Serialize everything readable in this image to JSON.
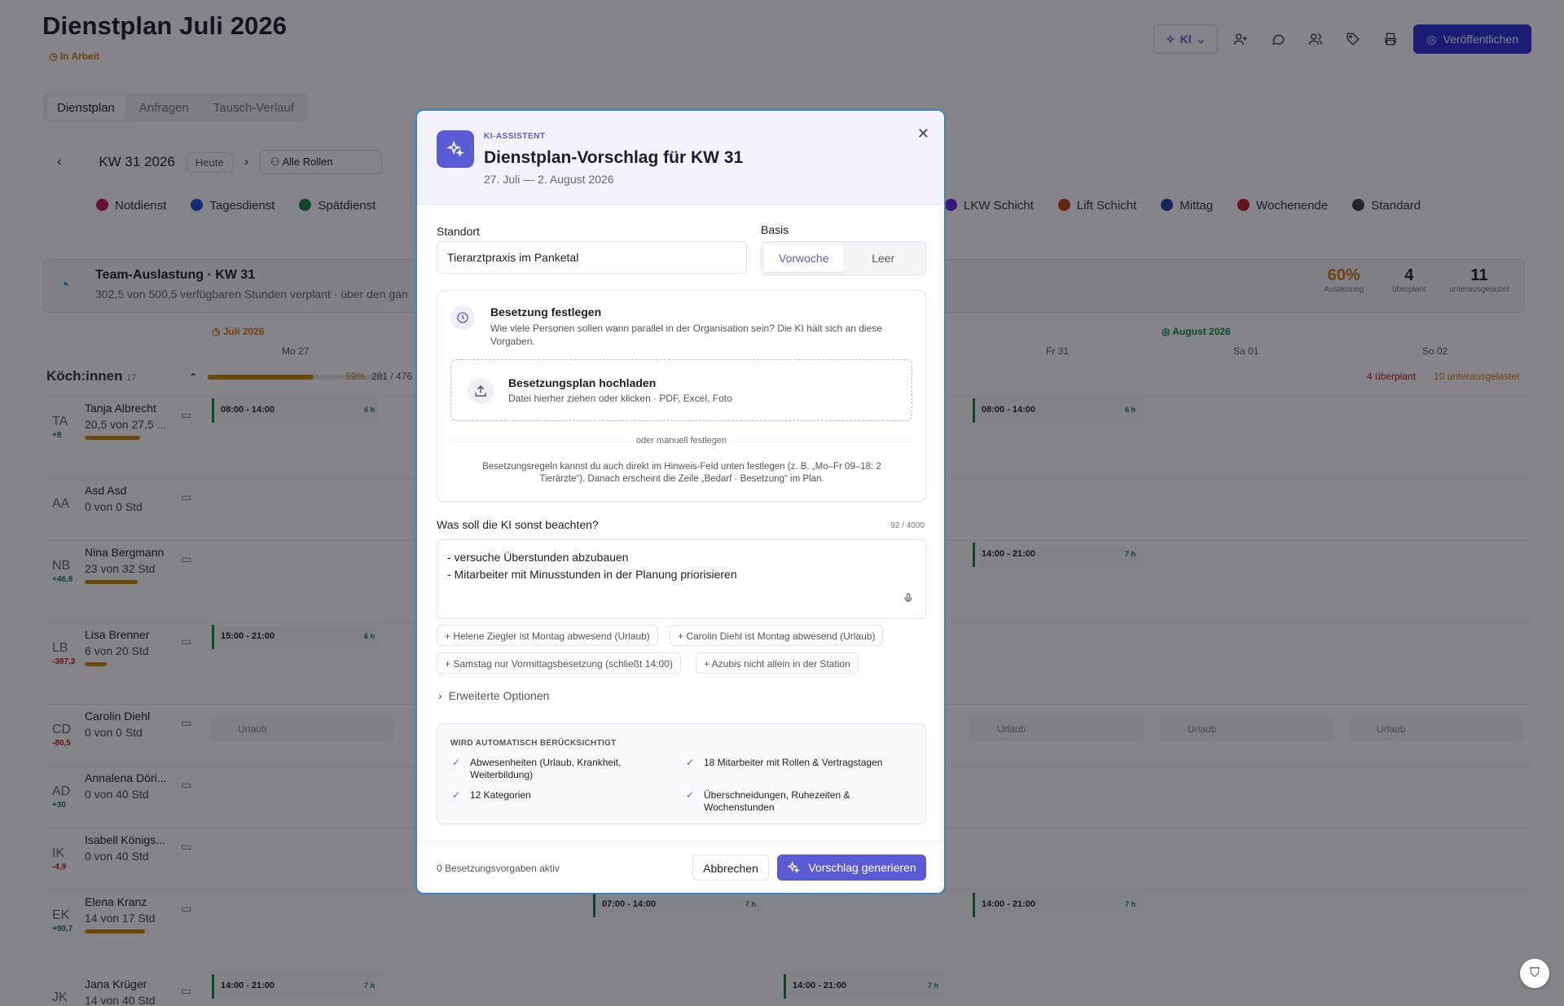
{
  "page": {
    "title": "Dienstplan Juli 2026",
    "status": "In Arbeit",
    "ki_label": "KI",
    "publish_label": "Veröffentlichen",
    "tabs": [
      "Dienstplan",
      "Anfragen",
      "Tausch-Verlauf"
    ],
    "week": "KW 31 2026",
    "today": "Heute",
    "roles": "Alle Rollen"
  },
  "legend_left": [
    {
      "label": "Notdienst",
      "color": "#be185d"
    },
    {
      "label": "Tagesdienst",
      "color": "#1d4ed8"
    },
    {
      "label": "Spätdienst",
      "color": "#15803d"
    }
  ],
  "legend_right": [
    {
      "label": "LKW Schicht",
      "color": "#6d28d9"
    },
    {
      "label": "Lift Schicht",
      "color": "#c2410c"
    },
    {
      "label": "Mittag",
      "color": "#1e40af"
    },
    {
      "label": "Wochenende",
      "color": "#b91c1c"
    },
    {
      "label": "Standard",
      "color": "#3f3f46"
    }
  ],
  "team": {
    "title": "Team-Auslastung · KW 31",
    "subtitle": "302,5 von 500,5 verfügbaren Stunden verplant · über den gan",
    "stats": [
      {
        "value": "60%",
        "label": "Auslastung",
        "color": "#d97706"
      },
      {
        "value": "4",
        "label": "überplant",
        "color": "#222"
      },
      {
        "value": "11",
        "label": "unterausgelastet",
        "color": "#222"
      }
    ]
  },
  "calendar": {
    "month_july": "Juli 2026",
    "month_aug": "August 2026",
    "days": [
      "Mo 27",
      "Fr 31",
      "Sa 01",
      "So 02"
    ],
    "group": "Köch:innen",
    "group_count": "17",
    "group_pct": "59%",
    "group_hours": "281 / 476",
    "group_progress": 0.59,
    "over": "4 überplant",
    "under": "10 unterausgelastet"
  },
  "employees": [
    {
      "ini": "TA",
      "name": "Tanja Albrecht",
      "hours": "20,5 von 27,5 ...",
      "bal": "+8",
      "balc": "#15803d",
      "bar": 0.75
    },
    {
      "ini": "AA",
      "name": "Asd Asd",
      "hours": "0 von 0 Std",
      "bal": "",
      "balc": "#15803d",
      "bar": 0
    },
    {
      "ini": "NB",
      "name": "Nina Bergmann",
      "hours": "23 von 32 Std",
      "bal": "+46,8",
      "balc": "#15803d",
      "bar": 0.72
    },
    {
      "ini": "LB",
      "name": "Lisa Brenner",
      "hours": "6 von 20 Std",
      "bal": "-387,3",
      "balc": "#b91c1c",
      "bar": 0.3
    },
    {
      "ini": "CD",
      "name": "Carolin Diehl",
      "hours": "0 von 0 Std",
      "bal": "-80,5",
      "balc": "#b91c1c",
      "bar": 0
    },
    {
      "ini": "AD",
      "name": "Annalena Döri...",
      "hours": "0 von 40 Std",
      "bal": "+30",
      "balc": "#15803d",
      "bar": 0
    },
    {
      "ini": "IK",
      "name": "Isabell Königs...",
      "hours": "0 von 40 Std",
      "bal": "-4,9",
      "balc": "#b91c1c",
      "bar": 0
    },
    {
      "ini": "EK",
      "name": "Elena Kranz",
      "hours": "14 von 17 Std",
      "bal": "+90,7",
      "balc": "#15803d",
      "bar": 0.82
    },
    {
      "ini": "JK",
      "name": "Jana Krüger",
      "hours": "14 von 40 Std",
      "bal": "",
      "balc": "#15803d",
      "bar": 0
    }
  ],
  "shifts": {
    "s1": "08:00 - 14:00",
    "s1h": "6 h",
    "s2": "08:00 - 14:00",
    "s2h": "6 h",
    "s3": "14:00 - 21:00",
    "s3h": "7 h",
    "s4": "15:00 - 21:00",
    "s4h": "6 h",
    "s5": "07:00 - 14:00",
    "s5h": "7 h",
    "s6": "14:00 - 21:00",
    "s6h": "7 h",
    "s7": "14:00 - 21:00",
    "s7h": "7 h",
    "s8": "14:00 - 21:00",
    "s8h": "7 h",
    "urlaub": "Urlaub"
  },
  "modal": {
    "eyebrow": "KI-ASSISTENT",
    "title": "Dienstplan-Vorschlag für KW 31",
    "date_range": "27. Juli — 2. August 2026",
    "standort_label": "Standort",
    "standort_value": "Tierarztpraxis im Panketal",
    "basis_label": "Basis",
    "basis_options": [
      "Vorwoche",
      "Leer"
    ],
    "besetzung_title": "Besetzung festlegen",
    "besetzung_desc": "Wie viele Personen sollen wann parallel in der Organisation sein? Die KI hält sich an diese Vorgaben.",
    "upload_title": "Besetzungsplan hochladen",
    "upload_sub": "Datei hierher ziehen oder klicken · PDF, Excel, Foto",
    "or_text": "oder manuell festlegen",
    "hint": "Besetzungsregeln kannst du auch direkt im Hinweis-Feld unten festlegen (z. B. „Mo–Fr 09–18: 2 Tierärzte“). Danach erscheint die Zeile „Bedarf · Besetzung“ im Plan.",
    "notes_label": "Was soll die KI sonst beachten?",
    "notes_counter": "92 / 4000",
    "notes_line1": "- versuche Überstunden abzubauen",
    "notes_line2": "- Mitarbeiter mit Minusstunden in der Planung priorisieren",
    "chips": [
      "+ Helene Ziegler ist Montag abwesend (Urlaub)",
      "+ Carolin Diehl ist Montag abwesend (Urlaub)",
      "+ Samstag nur Vormittagsbesetzung (schließt 14:00)",
      "+ Azubis nicht allein in der Station"
    ],
    "advanced": "Erweiterte Optionen",
    "auto_title": "WIRD AUTOMATISCH BERÜCKSICHTIGT",
    "auto_items": [
      "Abwesenheiten (Urlaub, Krankheit, Weiterbildung)",
      "18 Mitarbeiter mit Rollen & Vertragstagen",
      "12 Kategorien",
      "Überschneidungen, Ruhezeiten & Wochenstunden"
    ],
    "footer_active": "0 Besetzungsvorgaben aktiv",
    "cancel": "Abbrechen",
    "generate": "Vorschlag generieren"
  }
}
